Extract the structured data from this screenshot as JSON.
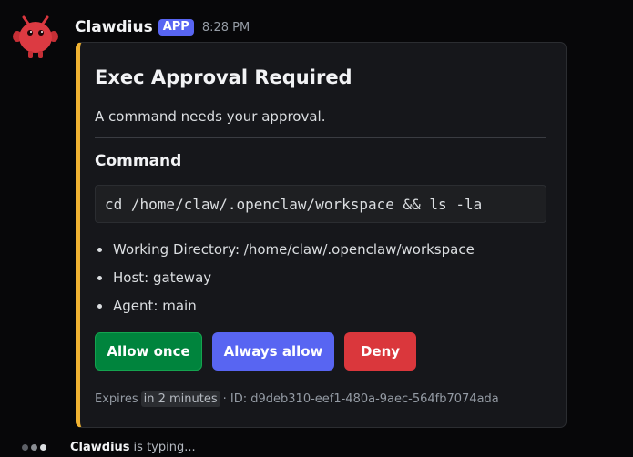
{
  "message": {
    "username": "Clawdius",
    "badge": "APP",
    "timestamp": "8:28 PM"
  },
  "embed": {
    "accent_color": "#f0b232",
    "title": "Exec Approval Required",
    "description": "A command needs your approval.",
    "field_title": "Command",
    "command": "cd /home/claw/.openclaw/workspace && ls -la",
    "details": [
      "Working Directory: /home/claw/.openclaw/workspace",
      "Host: gateway",
      "Agent: main"
    ],
    "buttons": {
      "allow_once": "Allow once",
      "always_allow": "Always allow",
      "deny": "Deny"
    },
    "footer": {
      "expires_prefix": "Expires",
      "expires_in": "in 2 minutes",
      "id_text": "· ID: d9deb310-eef1-480a-9aec-564fb7074ada"
    }
  },
  "typing": {
    "name": "Clawdius",
    "text": "is typing..."
  },
  "colors": {
    "background": "#070709",
    "badge": "#5865f2",
    "allow_once": "#00843d",
    "always_allow": "#5865f2",
    "deny": "#da373c"
  }
}
